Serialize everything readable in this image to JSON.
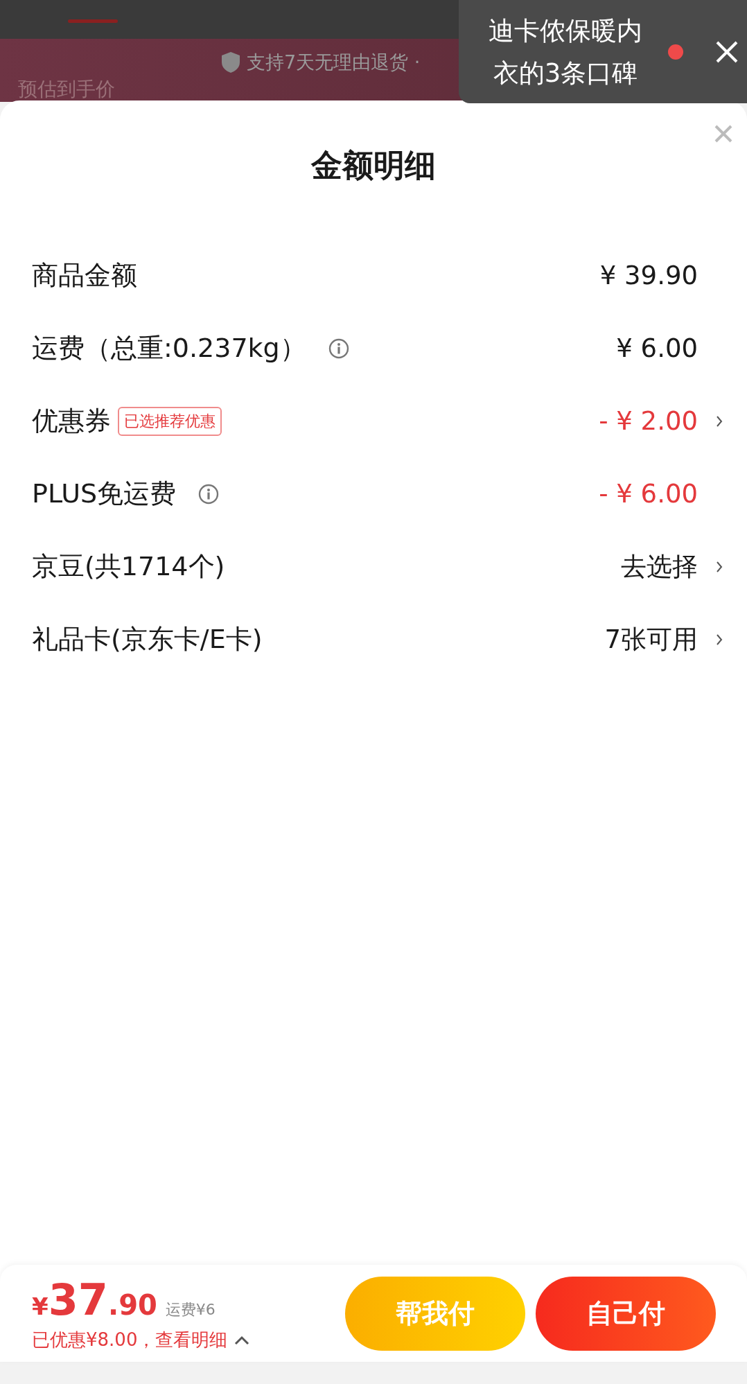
{
  "background": {
    "notice": "支持7天无理由退货 ·",
    "price_label": "预估到手价"
  },
  "popup": {
    "lines": [
      "迪卡侬保暖内",
      "衣的3条口碑"
    ],
    "unread": true
  },
  "sheet": {
    "title": "金额明细",
    "rows": [
      {
        "label": "商品金额",
        "value": "¥ 39.90",
        "info": false,
        "arrow": false,
        "discount": false
      },
      {
        "label": "运费（总重:0.237kg）",
        "value": "¥ 6.00",
        "info": true,
        "arrow": false,
        "discount": false
      },
      {
        "label": "优惠券",
        "tag": "已选推荐优惠",
        "value": "- ¥ 2.00",
        "info": false,
        "arrow": true,
        "discount": true
      },
      {
        "label": "PLUS免运费",
        "value": "- ¥ 6.00",
        "info": true,
        "arrow": false,
        "discount": true
      },
      {
        "label": "京豆(共1714个)",
        "value": "去选择",
        "info": false,
        "arrow": true,
        "discount": false
      },
      {
        "label": "礼品卡(京东卡/E卡)",
        "value": "7张可用",
        "info": false,
        "arrow": true,
        "discount": false
      }
    ]
  },
  "footer": {
    "currency": "¥",
    "price_int": "37",
    "price_dec": ".90",
    "shipping": "运费¥6",
    "saved": "已优惠¥8.00，查看明细",
    "expanded": true,
    "buttons": [
      {
        "label": "帮我付",
        "kind": "secondary"
      },
      {
        "label": "自己付",
        "kind": "primary"
      }
    ]
  }
}
